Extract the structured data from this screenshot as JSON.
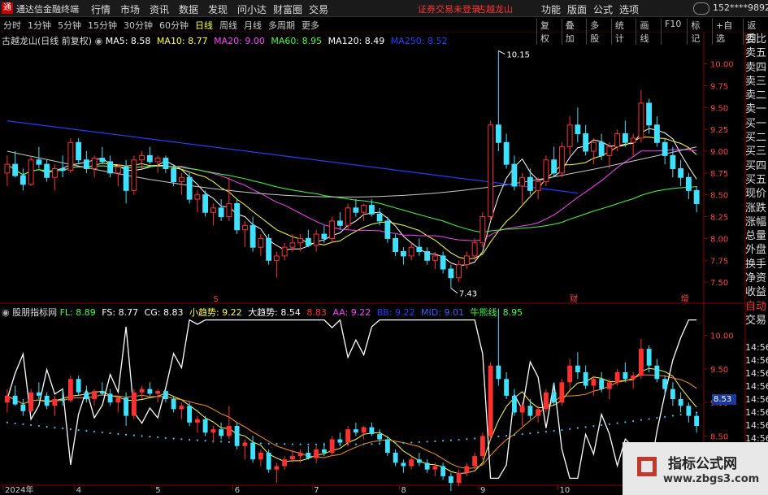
{
  "window": {
    "logo_glyph": "通",
    "app_title": "通达信金融终端",
    "menu": [
      "行情",
      "市场",
      "资讯",
      "数据",
      "发现",
      "问小达",
      "财富圈",
      "交易"
    ],
    "warning": "证券交易未登录",
    "stock_name_top": "古越龙山",
    "right_menu": [
      "功能",
      "版面",
      "公式",
      "选项"
    ],
    "user": "152****9892",
    "buttons": [
      "—",
      "□",
      "✕"
    ]
  },
  "toolbar": {
    "periods": [
      "分时",
      "1分钟",
      "5分钟",
      "15分钟",
      "30分钟",
      "60分钟",
      "日线",
      "周线",
      "月线",
      "多周期",
      "更多"
    ],
    "active_period": "日线",
    "right_tools": [
      "复权",
      "叠加",
      "多股",
      "统计",
      "画线",
      "F10",
      "标记",
      "+自选",
      "返回"
    ]
  },
  "main_legend": {
    "title": "古越龙山(日线 前复权)",
    "items": [
      {
        "label": "MA5: 8.58",
        "color": "#ffffff"
      },
      {
        "label": "MA10: 8.77",
        "color": "#ffff40"
      },
      {
        "label": "MA20: 9.00",
        "color": "#ff40ff"
      },
      {
        "label": "MA60: 8.95",
        "color": "#40ff40"
      },
      {
        "label": "MA120: 8.49",
        "color": "#ffffff"
      },
      {
        "label": "MA250: 8.52",
        "color": "#2040ff"
      }
    ]
  },
  "sub_legend": {
    "title": "股朋指标网",
    "items": [
      {
        "label": "FL: 8.89",
        "color": "#40ff40"
      },
      {
        "label": "FS: 8.77",
        "color": "#ffffff"
      },
      {
        "label": "CG: 8.83",
        "color": "#ffffff"
      },
      {
        "label": "小趋势: 9.22",
        "color": "#ffff40"
      },
      {
        "label": "大趋势: 8.54",
        "color": "#ffffff"
      },
      {
        "label": "8.83",
        "color": "#ff3030"
      },
      {
        "label": "AA: 9.22",
        "color": "#ff40ff"
      },
      {
        "label": "BB: 9.22",
        "color": "#2040ff"
      },
      {
        "label": "MID: 9.01",
        "color": "#4060ff"
      },
      {
        "label": "牛熊线: 8.95",
        "color": "#40ff40"
      }
    ]
  },
  "side_panel": [
    "委比",
    "卖五",
    "卖四",
    "卖三",
    "卖二",
    "卖一",
    "买一",
    "买二",
    "买三",
    "买四",
    "买五",
    "现价",
    "涨跌",
    "涨幅",
    "总量",
    "外盘",
    "换手",
    "净资",
    "收益",
    "自动",
    "交易"
  ],
  "time_column": [
    "14:56",
    "14:56",
    "14:56",
    "14:56",
    "14:56",
    "14:56",
    "14:56",
    "14:56"
  ],
  "price_badge": "8.53",
  "watermark": {
    "title": "指标公式网",
    "url": "www.zbgs3.com"
  },
  "chart_data": [
    {
      "type": "candlestick",
      "title": "古越龙山(日线 前复权)",
      "y_ticks": [
        10.0,
        9.75,
        9.5,
        9.25,
        9.0,
        8.75,
        8.5,
        8.25,
        8.0,
        7.75,
        7.5
      ],
      "ylim": [
        7.38,
        10.22
      ],
      "annotations": [
        {
          "label": "10.15",
          "type": "high"
        },
        {
          "label": "7.43",
          "type": "low"
        }
      ],
      "markers": [
        "S",
        "财",
        "增"
      ],
      "candles": [
        [
          8.75,
          8.95,
          8.6,
          8.85
        ],
        [
          8.85,
          9.0,
          8.7,
          8.72
        ],
        [
          8.72,
          8.8,
          8.55,
          8.62
        ],
        [
          8.62,
          8.95,
          8.6,
          8.9
        ],
        [
          8.9,
          9.05,
          8.8,
          8.85
        ],
        [
          8.85,
          8.9,
          8.65,
          8.7
        ],
        [
          8.7,
          8.85,
          8.55,
          8.8
        ],
        [
          8.8,
          8.95,
          8.7,
          8.78
        ],
        [
          8.78,
          9.15,
          8.75,
          9.1
        ],
        [
          9.1,
          9.15,
          8.85,
          8.9
        ],
        [
          8.9,
          9.0,
          8.75,
          8.8
        ],
        [
          8.8,
          8.95,
          8.7,
          8.92
        ],
        [
          8.92,
          9.05,
          8.85,
          8.88
        ],
        [
          8.88,
          8.95,
          8.7,
          8.75
        ],
        [
          8.75,
          8.85,
          8.6,
          8.82
        ],
        [
          8.82,
          8.9,
          8.4,
          8.55
        ],
        [
          8.55,
          8.95,
          8.5,
          8.9
        ],
        [
          8.9,
          9.0,
          8.8,
          8.95
        ],
        [
          8.95,
          9.05,
          8.85,
          8.88
        ],
        [
          8.88,
          8.95,
          8.75,
          8.92
        ],
        [
          8.92,
          8.95,
          8.75,
          8.8
        ],
        [
          8.8,
          8.85,
          8.6,
          8.65
        ],
        [
          8.65,
          8.75,
          8.5,
          8.7
        ],
        [
          8.7,
          8.75,
          8.4,
          8.45
        ],
        [
          8.45,
          8.55,
          8.3,
          8.5
        ],
        [
          8.5,
          8.55,
          8.25,
          8.3
        ],
        [
          8.3,
          8.4,
          8.15,
          8.35
        ],
        [
          8.35,
          8.45,
          8.2,
          8.25
        ],
        [
          8.25,
          8.7,
          8.2,
          8.4
        ],
        [
          8.4,
          8.45,
          8.05,
          8.1
        ],
        [
          8.1,
          8.2,
          7.9,
          8.15
        ],
        [
          8.15,
          8.25,
          7.85,
          7.9
        ],
        [
          7.9,
          8.05,
          7.8,
          8.0
        ],
        [
          8.0,
          8.05,
          7.7,
          7.75
        ],
        [
          7.75,
          7.85,
          7.55,
          7.8
        ],
        [
          7.8,
          7.95,
          7.75,
          7.9
        ],
        [
          7.9,
          8.05,
          7.85,
          7.95
        ],
        [
          7.95,
          8.05,
          7.85,
          8.0
        ],
        [
          8.0,
          8.1,
          7.9,
          7.92
        ],
        [
          7.92,
          8.1,
          7.85,
          8.05
        ],
        [
          8.05,
          8.15,
          7.95,
          8.0
        ],
        [
          8.0,
          8.25,
          7.95,
          8.2
        ],
        [
          8.2,
          8.3,
          8.1,
          8.15
        ],
        [
          8.15,
          8.4,
          8.1,
          8.35
        ],
        [
          8.35,
          8.45,
          8.25,
          8.3
        ],
        [
          8.3,
          8.4,
          8.2,
          8.38
        ],
        [
          8.38,
          8.45,
          8.25,
          8.28
        ],
        [
          8.28,
          8.35,
          8.15,
          8.2
        ],
        [
          8.2,
          8.25,
          7.95,
          8.0
        ],
        [
          8.0,
          8.05,
          7.8,
          7.85
        ],
        [
          7.85,
          7.9,
          7.7,
          7.8
        ],
        [
          7.8,
          7.95,
          7.75,
          7.9
        ],
        [
          7.9,
          8.0,
          7.8,
          7.85
        ],
        [
          7.85,
          7.9,
          7.7,
          7.75
        ],
        [
          7.75,
          7.85,
          7.65,
          7.8
        ],
        [
          7.8,
          7.85,
          7.6,
          7.65
        ],
        [
          7.65,
          7.7,
          7.43,
          7.55
        ],
        [
          7.55,
          7.75,
          7.5,
          7.7
        ],
        [
          7.7,
          7.85,
          7.65,
          7.8
        ],
        [
          7.8,
          8.0,
          7.75,
          7.95
        ],
        [
          7.95,
          8.3,
          7.9,
          8.25
        ],
        [
          8.25,
          9.35,
          8.2,
          9.3
        ],
        [
          9.3,
          10.15,
          9.0,
          9.1
        ],
        [
          9.1,
          9.2,
          8.8,
          8.85
        ],
        [
          8.85,
          8.95,
          8.55,
          8.6
        ],
        [
          8.6,
          8.75,
          8.4,
          8.7
        ],
        [
          8.7,
          8.8,
          8.5,
          8.55
        ],
        [
          8.55,
          8.7,
          8.45,
          8.65
        ],
        [
          8.65,
          8.95,
          8.6,
          8.9
        ],
        [
          8.9,
          9.05,
          8.7,
          8.75
        ],
        [
          8.75,
          9.1,
          8.7,
          9.05
        ],
        [
          9.05,
          9.4,
          8.95,
          9.3
        ],
        [
          9.3,
          9.5,
          9.1,
          9.2
        ],
        [
          9.2,
          9.3,
          8.95,
          9.0
        ],
        [
          9.0,
          9.15,
          8.85,
          9.1
        ],
        [
          9.1,
          9.2,
          8.9,
          8.95
        ],
        [
          8.95,
          9.1,
          8.8,
          9.05
        ],
        [
          9.05,
          9.25,
          9.0,
          9.2
        ],
        [
          9.2,
          9.35,
          9.05,
          9.1
        ],
        [
          9.1,
          9.2,
          8.95,
          9.15
        ],
        [
          9.15,
          9.7,
          9.1,
          9.55
        ],
        [
          9.55,
          9.6,
          9.2,
          9.3
        ],
        [
          9.3,
          9.4,
          9.05,
          9.1
        ],
        [
          9.1,
          9.15,
          8.85,
          8.95
        ],
        [
          8.95,
          9.05,
          8.7,
          8.8
        ],
        [
          8.8,
          8.9,
          8.6,
          8.7
        ],
        [
          8.7,
          8.75,
          8.45,
          8.55
        ],
        [
          8.55,
          8.6,
          8.3,
          8.4
        ]
      ]
    },
    {
      "type": "line",
      "title": "股朋指标网",
      "y_ticks": [
        10.0,
        9.5,
        9.0,
        8.5,
        8.0
      ],
      "ylim": [
        7.85,
        10.25
      ]
    }
  ],
  "x_axis": [
    "2024年",
    "4",
    "5",
    "6",
    "7",
    "8",
    "9",
    "10",
    "11",
    "12"
  ]
}
